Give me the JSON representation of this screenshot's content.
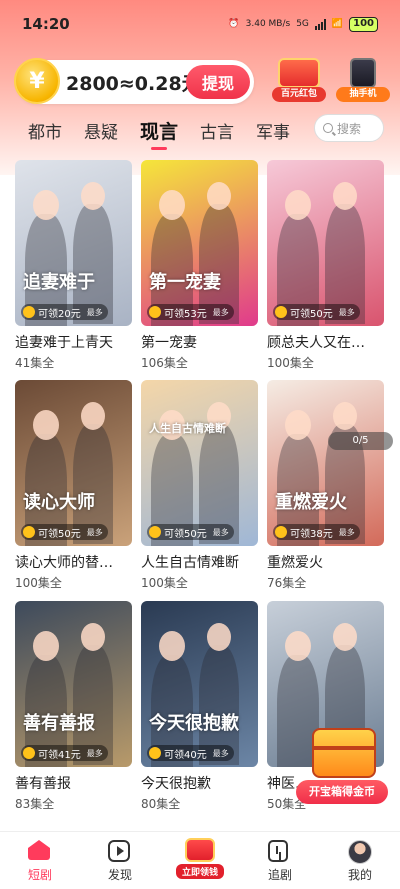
{
  "status": {
    "time": "14:20",
    "speed": "3.40 MB/s",
    "network": "5G",
    "battery": "100"
  },
  "header": {
    "coin_symbol": "¥",
    "balance_text": "2800≈0.28元",
    "withdraw_label": "提现",
    "promo_red_label": "百元红包",
    "promo_phone_label": "抽手机"
  },
  "tabs": [
    {
      "label": "都市",
      "active": false
    },
    {
      "label": "悬疑",
      "active": false
    },
    {
      "label": "现言",
      "active": true
    },
    {
      "label": "古言",
      "active": false
    },
    {
      "label": "军事",
      "active": false
    }
  ],
  "search": {
    "placeholder": "搜索"
  },
  "cards": [
    {
      "title": "追妻难于上青天",
      "eps": "41集全",
      "reward": "可领20元",
      "max": "最多",
      "poster_text": "追妻难于",
      "colors": [
        "#dfe3ea",
        "#a9b3c4"
      ]
    },
    {
      "title": "第一宠妻",
      "eps": "106集全",
      "reward": "可领53元",
      "max": "最多",
      "poster_text": "第一宠妻",
      "colors": [
        "#f5e63a",
        "#e03a8c"
      ]
    },
    {
      "title": "顾总夫人又在…",
      "eps": "100集全",
      "reward": "可领50元",
      "max": "最多",
      "poster_text": "",
      "colors": [
        "#f6c9d8",
        "#d9546e"
      ]
    },
    {
      "title": "读心大师的替…",
      "eps": "100集全",
      "reward": "可领50元",
      "max": "最多",
      "poster_text": "读心大师",
      "colors": [
        "#6b4a36",
        "#caa27a"
      ]
    },
    {
      "title": "人生自古情难断",
      "eps": "100集全",
      "reward": "可领50元",
      "max": "最多",
      "poster_text": "人生自古情难断",
      "colors": [
        "#f4d6a8",
        "#9fb7d6"
      ]
    },
    {
      "title": "重燃爱火",
      "eps": "76集全",
      "reward": "可领38元",
      "max": "最多",
      "poster_text": "重燃爱火",
      "colors": [
        "#f5ece4",
        "#d36a5a"
      ]
    },
    {
      "title": "善有善报",
      "eps": "83集全",
      "reward": "可领41元",
      "max": "最多",
      "poster_text": "善有善报",
      "colors": [
        "#3d4a5c",
        "#b89a6a"
      ]
    },
    {
      "title": "今天很抱歉",
      "eps": "80集全",
      "reward": "可领40元",
      "max": "最多",
      "poster_text": "今天很抱歉",
      "colors": [
        "#2a3a52",
        "#6c86a6"
      ]
    },
    {
      "title": "神医…",
      "eps": "50集全",
      "reward": "",
      "max": "",
      "poster_text": "",
      "colors": [
        "#c7cfd9",
        "#6d7f94"
      ]
    }
  ],
  "overlay": {
    "progress": "0/5",
    "treasure_label": "开宝箱得金币"
  },
  "bottom_nav": [
    {
      "label": "短剧",
      "icon": "home-icon",
      "active": true
    },
    {
      "label": "发现",
      "icon": "play-square-icon",
      "active": false
    },
    {
      "label": "立即领钱",
      "icon": "cash-envelope-icon",
      "active": false
    },
    {
      "label": "追剧",
      "icon": "bookmark-icon",
      "active": false
    },
    {
      "label": "我的",
      "icon": "avatar-icon",
      "active": false
    }
  ]
}
